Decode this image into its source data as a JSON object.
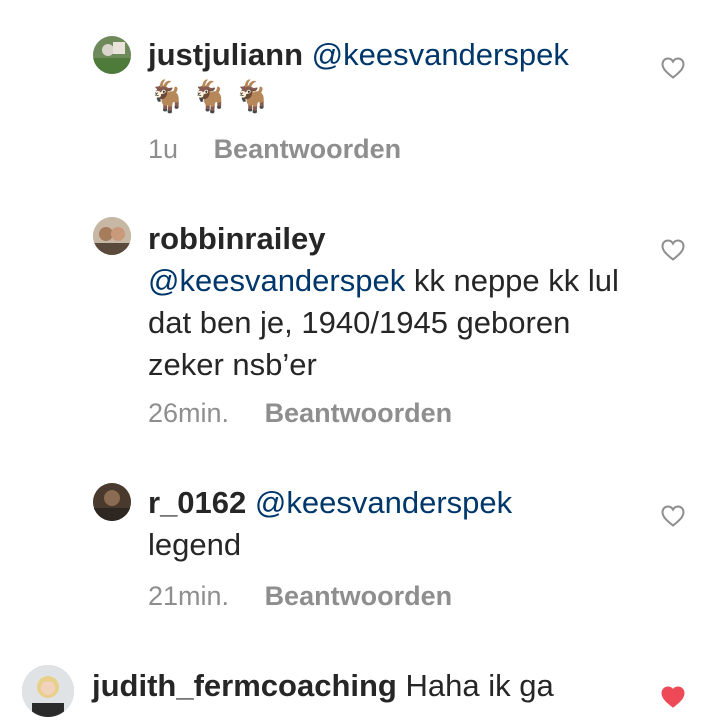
{
  "comments": [
    {
      "username": "justjuliann",
      "mention": "@keesvanderspek",
      "text": "🐐🐐🐐",
      "time": "1u",
      "reply_label": "Beantwoorden",
      "liked": false
    },
    {
      "username": "robbinrailey",
      "mention": "@keesvanderspek",
      "text": "kk neppe kk lul dat ben je, 1940/1945 geboren zeker nsb’er",
      "time": "26min.",
      "reply_label": "Beantwoorden",
      "liked": false
    },
    {
      "username": "r_0162",
      "mention": "@keesvanderspek",
      "text": "legend",
      "time": "21min.",
      "reply_label": "Beantwoorden",
      "liked": false
    },
    {
      "username": "judith_fermcoaching",
      "mention": "",
      "text": "Haha ik ga",
      "liked": true
    }
  ],
  "colors": {
    "mention": "#00376b",
    "meta": "#8e8e8e",
    "heart_liked": "#ed4956",
    "heart_outline": "#8e8e8e"
  }
}
